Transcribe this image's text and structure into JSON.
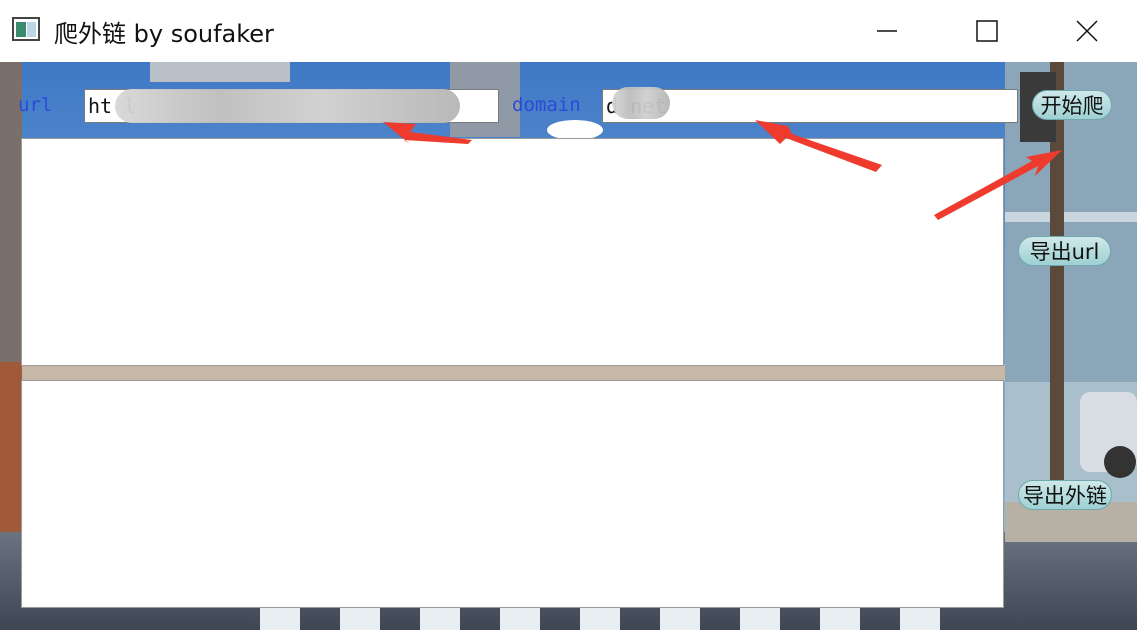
{
  "window": {
    "title": "爬外链  by soufaker"
  },
  "form": {
    "url_label": "url",
    "url_value": "ht         l",
    "domain_label": "domain",
    "domain_value": "d    net"
  },
  "buttons": {
    "start": "开始爬",
    "export_url": "导出url",
    "export_links": "导出外链"
  },
  "colors": {
    "label_blue": "#2a4bd7",
    "annotation_red": "#ef3b2d",
    "button_teal": "#9ed0d3"
  },
  "icons": [
    "app-icon",
    "minimize-icon",
    "maximize-icon",
    "close-icon"
  ]
}
